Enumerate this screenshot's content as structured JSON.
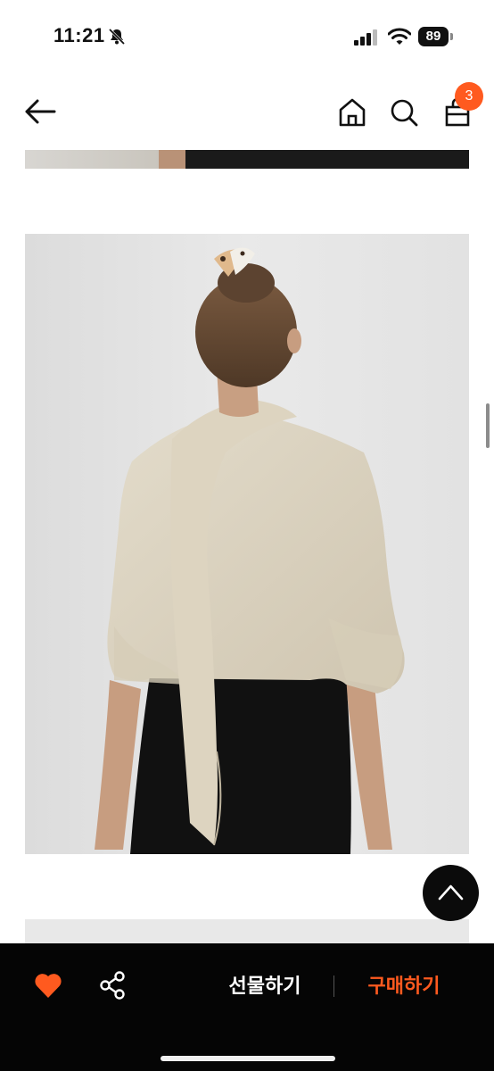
{
  "status_bar": {
    "time": "11:21",
    "battery": "89"
  },
  "header": {
    "cart_count": "3"
  },
  "bottom_bar": {
    "gift_label": "선물하기",
    "buy_label": "구매하기"
  },
  "colors": {
    "accent": "#ff5a1f",
    "bar_bg": "#050505"
  },
  "icons": [
    "bell-slash-icon",
    "signal-icon",
    "wifi-icon",
    "back-icon",
    "home-icon",
    "search-icon",
    "bag-icon",
    "chevron-up-icon",
    "heart-icon",
    "share-icon"
  ]
}
